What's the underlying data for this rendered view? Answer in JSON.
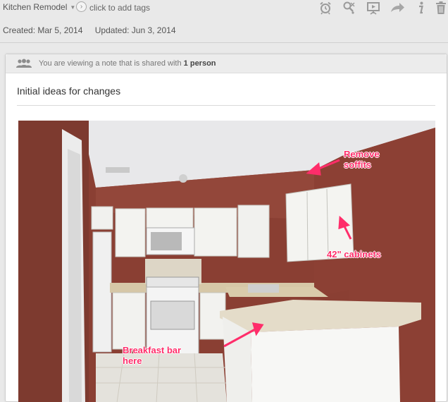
{
  "header": {
    "notebook_name": "Kitchen Remodel",
    "tag_placeholder": "click to add tags",
    "toolbar": {
      "icons": [
        "alarm-icon",
        "find-icon",
        "presentation-icon",
        "share-icon",
        "info-icon",
        "trash-icon"
      ]
    }
  },
  "meta": {
    "created": "Created: Mar 5, 2014",
    "updated": "Updated: Jun 3, 2014"
  },
  "share_bar": {
    "prefix": "You are viewing a note that is shared with",
    "count": "1 person"
  },
  "note": {
    "title": "Initial ideas for changes",
    "image": {
      "description_icon": "kitchen-photo",
      "annotations": {
        "remove_soffits_line1": "Remove",
        "remove_soffits_line2": "soffits",
        "cabinets": "42\" cabinets",
        "breakfast_line1": "Breakfast bar",
        "breakfast_line2": "here"
      }
    }
  },
  "colors": {
    "annotation": "#ff2d6a",
    "wall": "#8a3f33",
    "background": "#e9e9e9"
  }
}
